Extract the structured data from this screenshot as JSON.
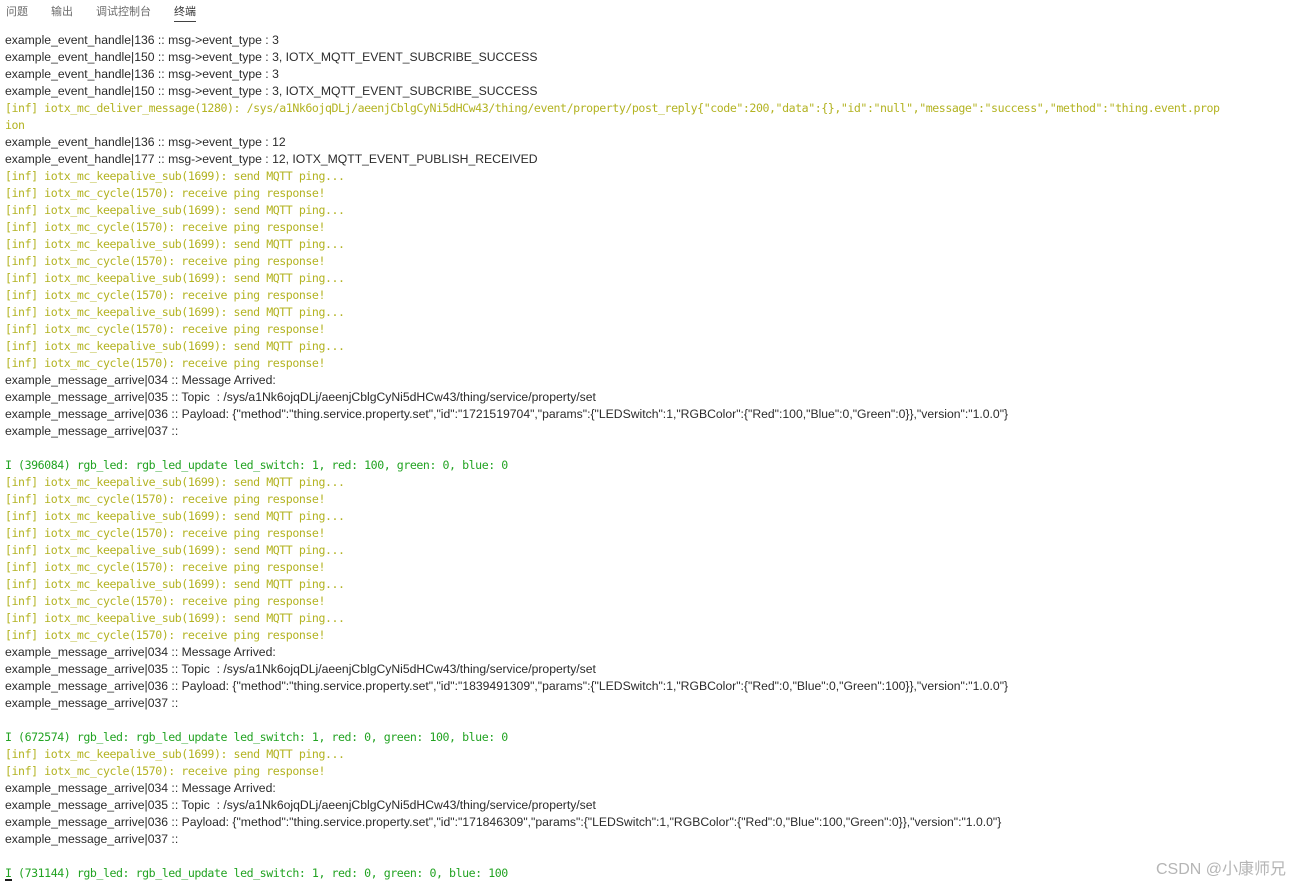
{
  "tabs": [
    {
      "label": "问题"
    },
    {
      "label": "输出"
    },
    {
      "label": "调试控制台"
    },
    {
      "label": "终端"
    }
  ],
  "active_tab": "终端",
  "colors": {
    "background": "#ffffff",
    "default_text": "#2b2b2b",
    "info_text": "#b3b322",
    "green_text": "#22a322",
    "watermark": "#b5b5b5"
  },
  "terminal": {
    "lines": [
      {
        "text": "example_event_handle|136 :: msg->event_type : 3",
        "kind": "normal"
      },
      {
        "text": "example_event_handle|150 :: msg->event_type : 3, IOTX_MQTT_EVENT_SUBCRIBE_SUCCESS",
        "kind": "normal"
      },
      {
        "text": "example_event_handle|136 :: msg->event_type : 3",
        "kind": "normal"
      },
      {
        "text": "example_event_handle|150 :: msg->event_type : 3, IOTX_MQTT_EVENT_SUBCRIBE_SUCCESS",
        "kind": "normal"
      },
      {
        "text": "[inf] iotx_mc_deliver_message(1280): /sys/a1Nk6ojqDLj/aeenjCblgCyNi5dHCw43/thing/event/property/post_reply{\"code\":200,\"data\":{},\"id\":\"null\",\"message\":\"success\",\"method\":\"thing.event.prop",
        "kind": "inf"
      },
      {
        "text": "ion",
        "kind": "inf"
      },
      {
        "text": "example_event_handle|136 :: msg->event_type : 12",
        "kind": "normal"
      },
      {
        "text": "example_event_handle|177 :: msg->event_type : 12, IOTX_MQTT_EVENT_PUBLISH_RECEIVED",
        "kind": "normal"
      },
      {
        "text": "[inf] iotx_mc_keepalive_sub(1699): send MQTT ping...",
        "kind": "inf"
      },
      {
        "text": "[inf] iotx_mc_cycle(1570): receive ping response!",
        "kind": "inf"
      },
      {
        "text": "[inf] iotx_mc_keepalive_sub(1699): send MQTT ping...",
        "kind": "inf"
      },
      {
        "text": "[inf] iotx_mc_cycle(1570): receive ping response!",
        "kind": "inf"
      },
      {
        "text": "[inf] iotx_mc_keepalive_sub(1699): send MQTT ping...",
        "kind": "inf"
      },
      {
        "text": "[inf] iotx_mc_cycle(1570): receive ping response!",
        "kind": "inf"
      },
      {
        "text": "[inf] iotx_mc_keepalive_sub(1699): send MQTT ping...",
        "kind": "inf"
      },
      {
        "text": "[inf] iotx_mc_cycle(1570): receive ping response!",
        "kind": "inf"
      },
      {
        "text": "[inf] iotx_mc_keepalive_sub(1699): send MQTT ping...",
        "kind": "inf"
      },
      {
        "text": "[inf] iotx_mc_cycle(1570): receive ping response!",
        "kind": "inf"
      },
      {
        "text": "[inf] iotx_mc_keepalive_sub(1699): send MQTT ping...",
        "kind": "inf"
      },
      {
        "text": "[inf] iotx_mc_cycle(1570): receive ping response!",
        "kind": "inf"
      },
      {
        "text": "example_message_arrive|034 :: Message Arrived:",
        "kind": "normal"
      },
      {
        "text": "example_message_arrive|035 :: Topic  : /sys/a1Nk6ojqDLj/aeenjCblgCyNi5dHCw43/thing/service/property/set",
        "kind": "normal"
      },
      {
        "text": "example_message_arrive|036 :: Payload: {\"method\":\"thing.service.property.set\",\"id\":\"1721519704\",\"params\":{\"LEDSwitch\":1,\"RGBColor\":{\"Red\":100,\"Blue\":0,\"Green\":0}},\"version\":\"1.0.0\"}",
        "kind": "normal"
      },
      {
        "text": "example_message_arrive|037 ::",
        "kind": "normal"
      },
      {
        "text": "",
        "kind": "normal"
      },
      {
        "text": "I (396084) rgb_led: rgb_led_update led_switch: 1, red: 100, green: 0, blue: 0",
        "kind": "green"
      },
      {
        "text": "[inf] iotx_mc_keepalive_sub(1699): send MQTT ping...",
        "kind": "inf"
      },
      {
        "text": "[inf] iotx_mc_cycle(1570): receive ping response!",
        "kind": "inf"
      },
      {
        "text": "[inf] iotx_mc_keepalive_sub(1699): send MQTT ping...",
        "kind": "inf"
      },
      {
        "text": "[inf] iotx_mc_cycle(1570): receive ping response!",
        "kind": "inf"
      },
      {
        "text": "[inf] iotx_mc_keepalive_sub(1699): send MQTT ping...",
        "kind": "inf"
      },
      {
        "text": "[inf] iotx_mc_cycle(1570): receive ping response!",
        "kind": "inf"
      },
      {
        "text": "[inf] iotx_mc_keepalive_sub(1699): send MQTT ping...",
        "kind": "inf"
      },
      {
        "text": "[inf] iotx_mc_cycle(1570): receive ping response!",
        "kind": "inf"
      },
      {
        "text": "[inf] iotx_mc_keepalive_sub(1699): send MQTT ping...",
        "kind": "inf"
      },
      {
        "text": "[inf] iotx_mc_cycle(1570): receive ping response!",
        "kind": "inf"
      },
      {
        "text": "example_message_arrive|034 :: Message Arrived:",
        "kind": "normal"
      },
      {
        "text": "example_message_arrive|035 :: Topic  : /sys/a1Nk6ojqDLj/aeenjCblgCyNi5dHCw43/thing/service/property/set",
        "kind": "normal"
      },
      {
        "text": "example_message_arrive|036 :: Payload: {\"method\":\"thing.service.property.set\",\"id\":\"1839491309\",\"params\":{\"LEDSwitch\":1,\"RGBColor\":{\"Red\":0,\"Blue\":0,\"Green\":100}},\"version\":\"1.0.0\"}",
        "kind": "normal"
      },
      {
        "text": "example_message_arrive|037 ::",
        "kind": "normal"
      },
      {
        "text": "",
        "kind": "normal"
      },
      {
        "text": "I (672574) rgb_led: rgb_led_update led_switch: 1, red: 0, green: 100, blue: 0",
        "kind": "green"
      },
      {
        "text": "[inf] iotx_mc_keepalive_sub(1699): send MQTT ping...",
        "kind": "inf"
      },
      {
        "text": "[inf] iotx_mc_cycle(1570): receive ping response!",
        "kind": "inf"
      },
      {
        "text": "example_message_arrive|034 :: Message Arrived:",
        "kind": "normal"
      },
      {
        "text": "example_message_arrive|035 :: Topic  : /sys/a1Nk6ojqDLj/aeenjCblgCyNi5dHCw43/thing/service/property/set",
        "kind": "normal"
      },
      {
        "text": "example_message_arrive|036 :: Payload: {\"method\":\"thing.service.property.set\",\"id\":\"171846309\",\"params\":{\"LEDSwitch\":1,\"RGBColor\":{\"Red\":0,\"Blue\":100,\"Green\":0}},\"version\":\"1.0.0\"}",
        "kind": "normal"
      },
      {
        "text": "example_message_arrive|037 ::",
        "kind": "normal"
      },
      {
        "text": "",
        "kind": "normal"
      },
      {
        "text": "I (731144) rgb_led: rgb_led_update led_switch: 1, red: 0, green: 0, blue: 100",
        "kind": "green"
      }
    ]
  },
  "watermark": "CSDN @小康师兄"
}
